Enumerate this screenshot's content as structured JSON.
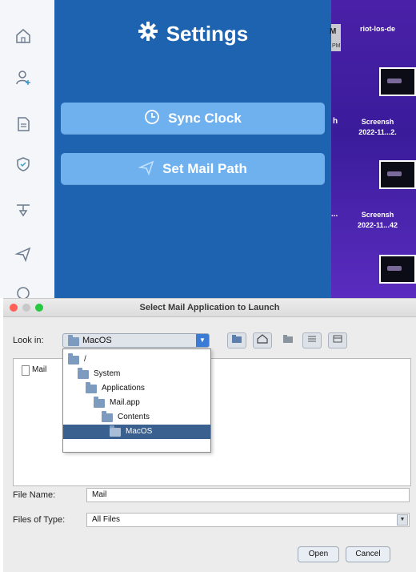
{
  "colors": {
    "settings_bg": "#1e63b0",
    "button_bg": "#6fb1ef",
    "desktop_bg": "#4a20a8",
    "selection": "#39608f"
  },
  "rail": {
    "icons": [
      "home-icon",
      "add-user-icon",
      "document-icon",
      "shield-icon",
      "filter-icon",
      "paper-plane-icon",
      "globe-icon"
    ]
  },
  "settings": {
    "title": "Settings",
    "buttons": [
      {
        "label": "Sync Clock",
        "icon": "clock-icon"
      },
      {
        "label": "Set Mail Path",
        "icon": "paper-plane-icon"
      }
    ]
  },
  "desktop": {
    "items": [
      {
        "text": "riot-los-de"
      },
      {
        "text": "Screensh\n2022-11...2."
      },
      {
        "text": "Screensh\n2022-11...42"
      }
    ],
    "partials": [
      "M",
      "h",
      "..."
    ],
    "badge": "PM"
  },
  "dialog": {
    "title": "Select Mail Application to Launch",
    "look_in_label": "Look in:",
    "look_in_value": "MacOS",
    "tree": [
      "/",
      "System",
      "Applications",
      "Mail.app",
      "Contents",
      "MacOS"
    ],
    "file_item": "Mail",
    "file_name_label": "File Name:",
    "file_name_value": "Mail",
    "files_of_type_label": "Files of Type:",
    "files_of_type_value": "All Files",
    "open_label": "Open",
    "cancel_label": "Cancel"
  }
}
